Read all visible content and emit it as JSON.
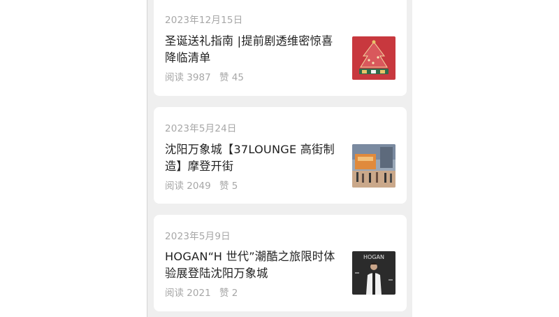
{
  "articles": [
    {
      "date": "2023年12月15日",
      "title": "圣诞送礼指南 |提前剧透维密惊喜降临清单",
      "reads_label": "阅读",
      "reads": "3987",
      "likes_label": "赞",
      "likes": "45",
      "thumb_icon": "christmas-tree-image",
      "thumb_colors": [
        "#c8383e",
        "#e8c46a",
        "#2f6b4a"
      ]
    },
    {
      "date": "2023年5月24日",
      "title": "沈阳万象城【37LOUNGE 高街制造】摩登开街",
      "reads_label": "阅读",
      "reads": "2049",
      "likes_label": "赞",
      "likes": "5",
      "thumb_icon": "street-event-image",
      "thumb_colors": [
        "#e08a3c",
        "#7a8aa0",
        "#caa88a"
      ]
    },
    {
      "date": "2023年5月9日",
      "title": "HOGAN“H 世代”潮酷之旅限时体验展登陆沈阳万象城",
      "reads_label": "阅读",
      "reads": "2021",
      "likes_label": "赞",
      "likes": "2",
      "thumb_icon": "hogan-portrait-image",
      "thumb_colors": [
        "#2b2b2b",
        "#e6e6e6",
        "#8a8a8a"
      ]
    }
  ]
}
